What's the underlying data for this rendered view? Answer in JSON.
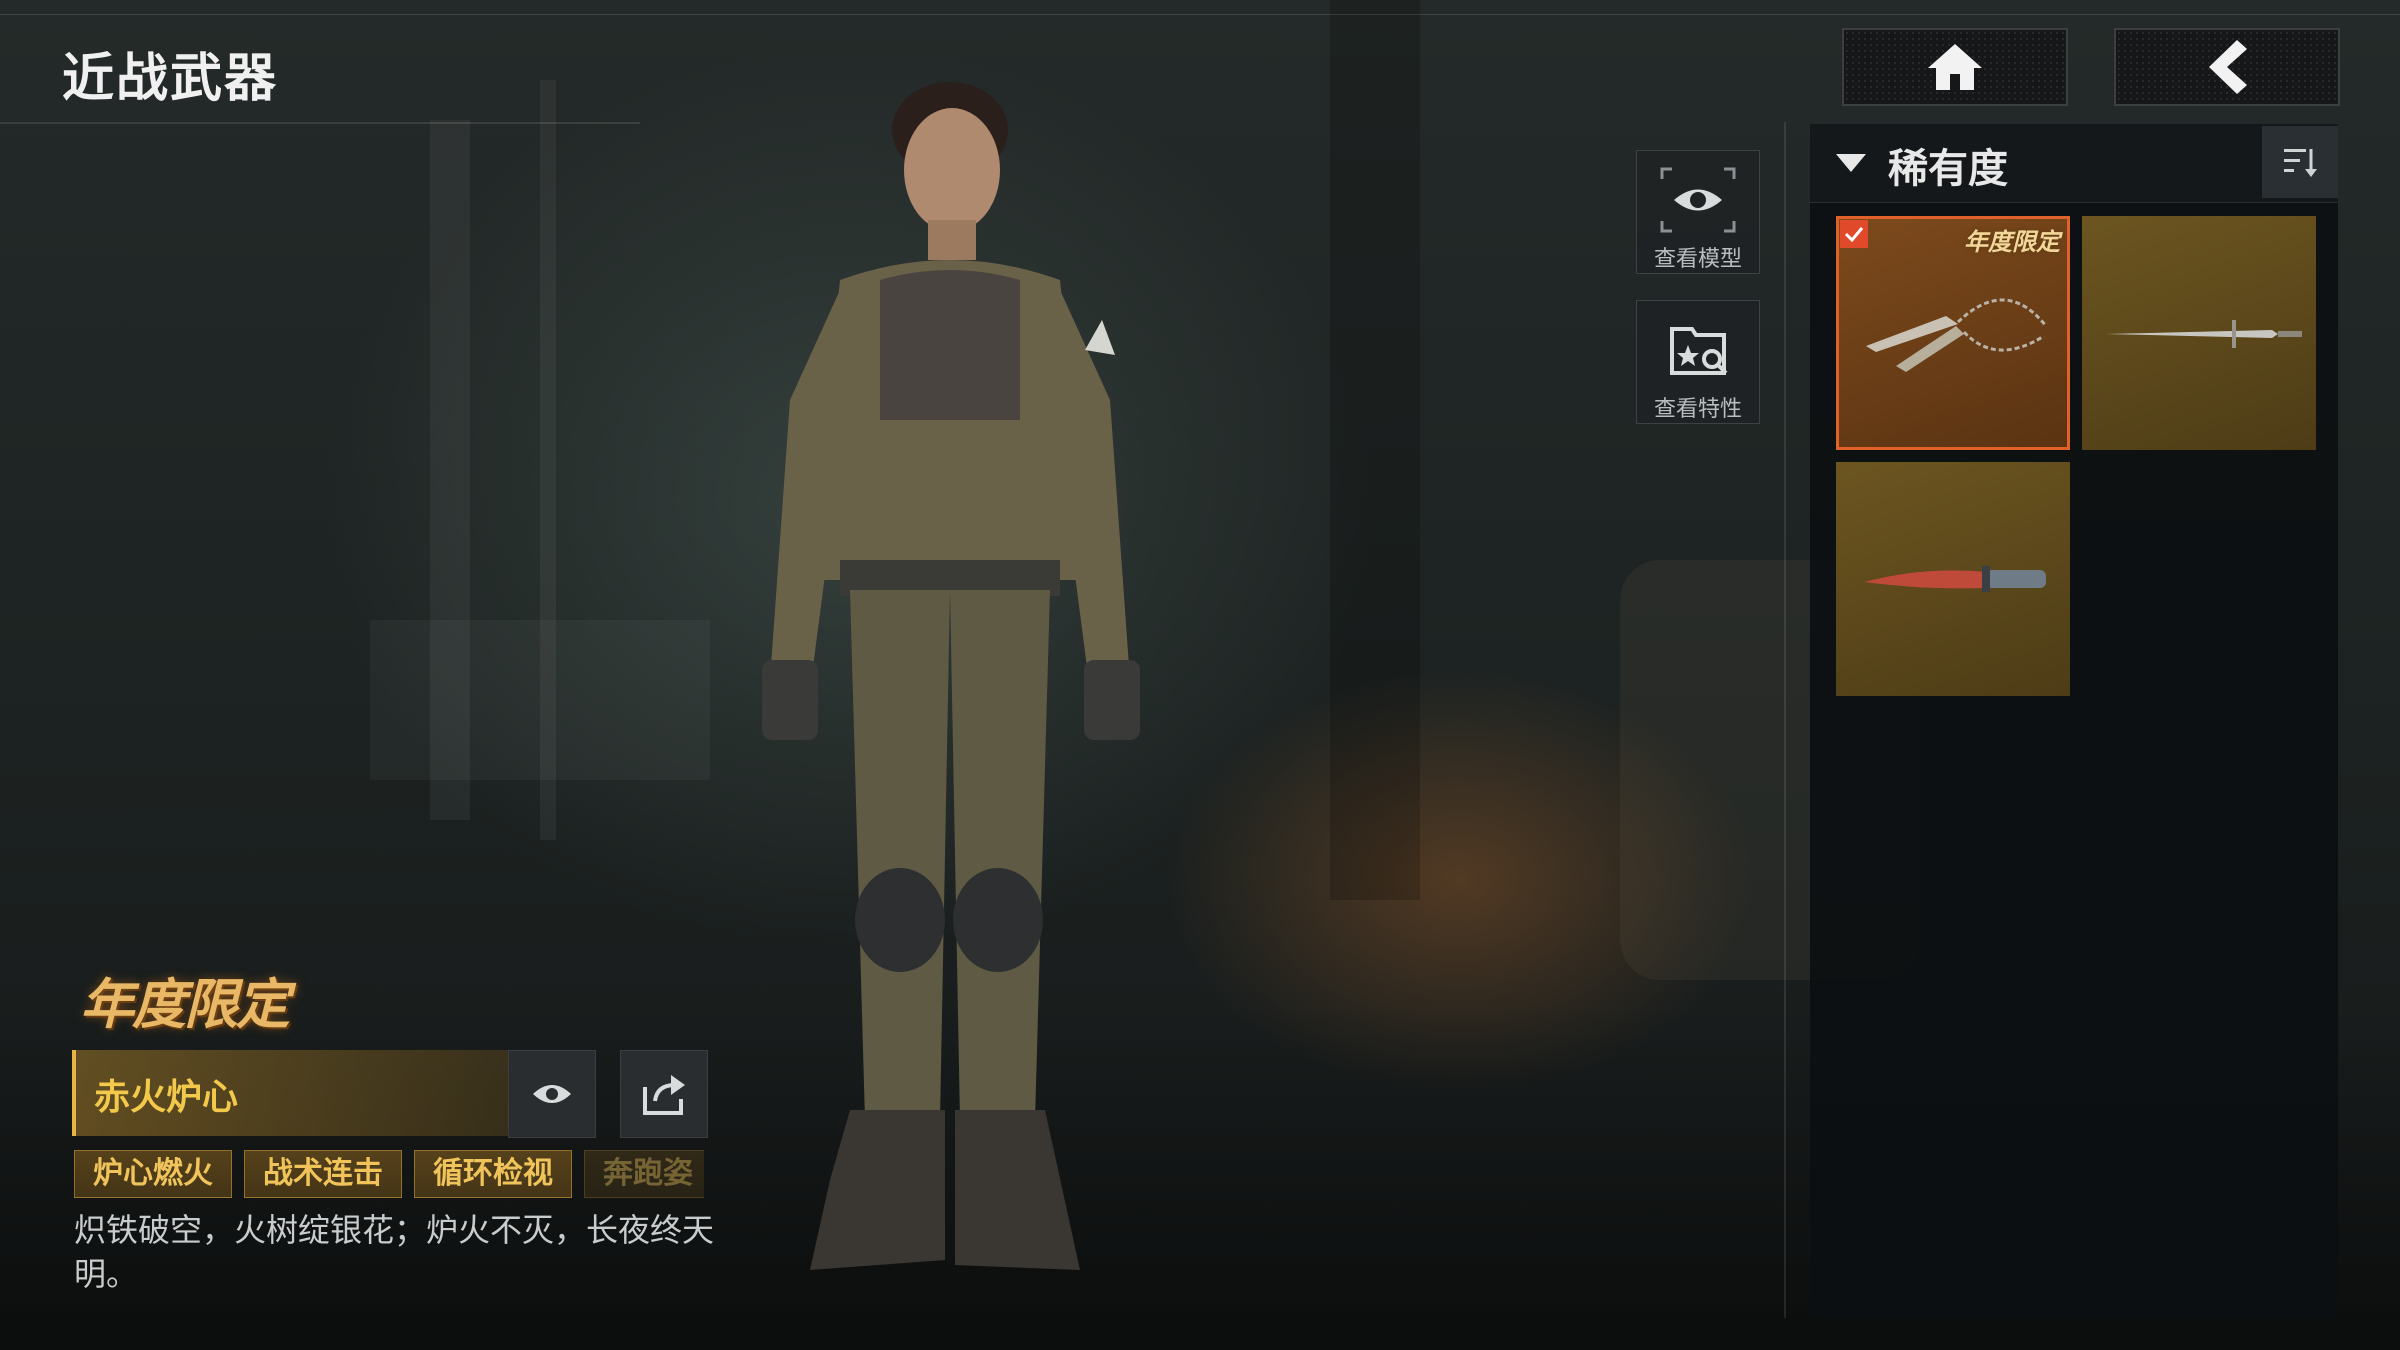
{
  "header": {
    "title": "近战武器"
  },
  "nav": {
    "home_icon": "home-icon",
    "back_icon": "back-chevron-icon"
  },
  "side_actions": [
    {
      "label": "查看模型",
      "icon": "eye-icon"
    },
    {
      "label": "查看特性",
      "icon": "trait-search-icon"
    }
  ],
  "filter": {
    "label": "稀有度",
    "expand_icon": "chevron-down-icon",
    "sort_icon": "sort-icon"
  },
  "items": [
    {
      "badge": "年度限定",
      "selected": true,
      "weapon": "chain-kunai"
    },
    {
      "badge": "",
      "selected": false,
      "weapon": "thin-sword"
    },
    {
      "badge": "",
      "selected": false,
      "weapon": "combat-knife"
    }
  ],
  "selected_item": {
    "badge": "年度限定",
    "name": "赤火炉心",
    "tags": [
      "炉心燃火",
      "战术连击",
      "循环检视",
      "奔跑姿"
    ],
    "description": "炽铁破空，火树绽银花；炉火不灭，长夜终天明。"
  },
  "colors": {
    "accent_gold": "#f3c94b",
    "selected_outline": "#e0622a",
    "tile_gold": "#6d5620"
  }
}
